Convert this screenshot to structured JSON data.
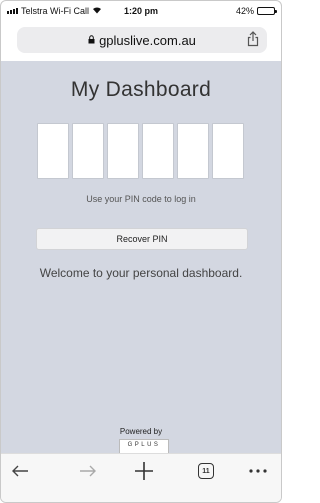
{
  "status_bar": {
    "carrier": "Telstra Wi-Fi Call",
    "time": "1:20 pm",
    "battery_percent": "42%",
    "battery_level": 0.42
  },
  "browser": {
    "url": "gpluslive.com.au",
    "tab_count": "11"
  },
  "page": {
    "title": "My Dashboard",
    "pin_box_count": 6,
    "pin_hint": "Use your PIN code to log in",
    "recover_label": "Recover PIN",
    "welcome": "Welcome to your personal dashboard.",
    "powered_by": "Powered by",
    "logo_text": "GPLUS"
  },
  "colors": {
    "page_background": "#d3d7e1",
    "logo_bar_dark": "#7a3b1f",
    "logo_bar_gold": "#d99a2b"
  }
}
